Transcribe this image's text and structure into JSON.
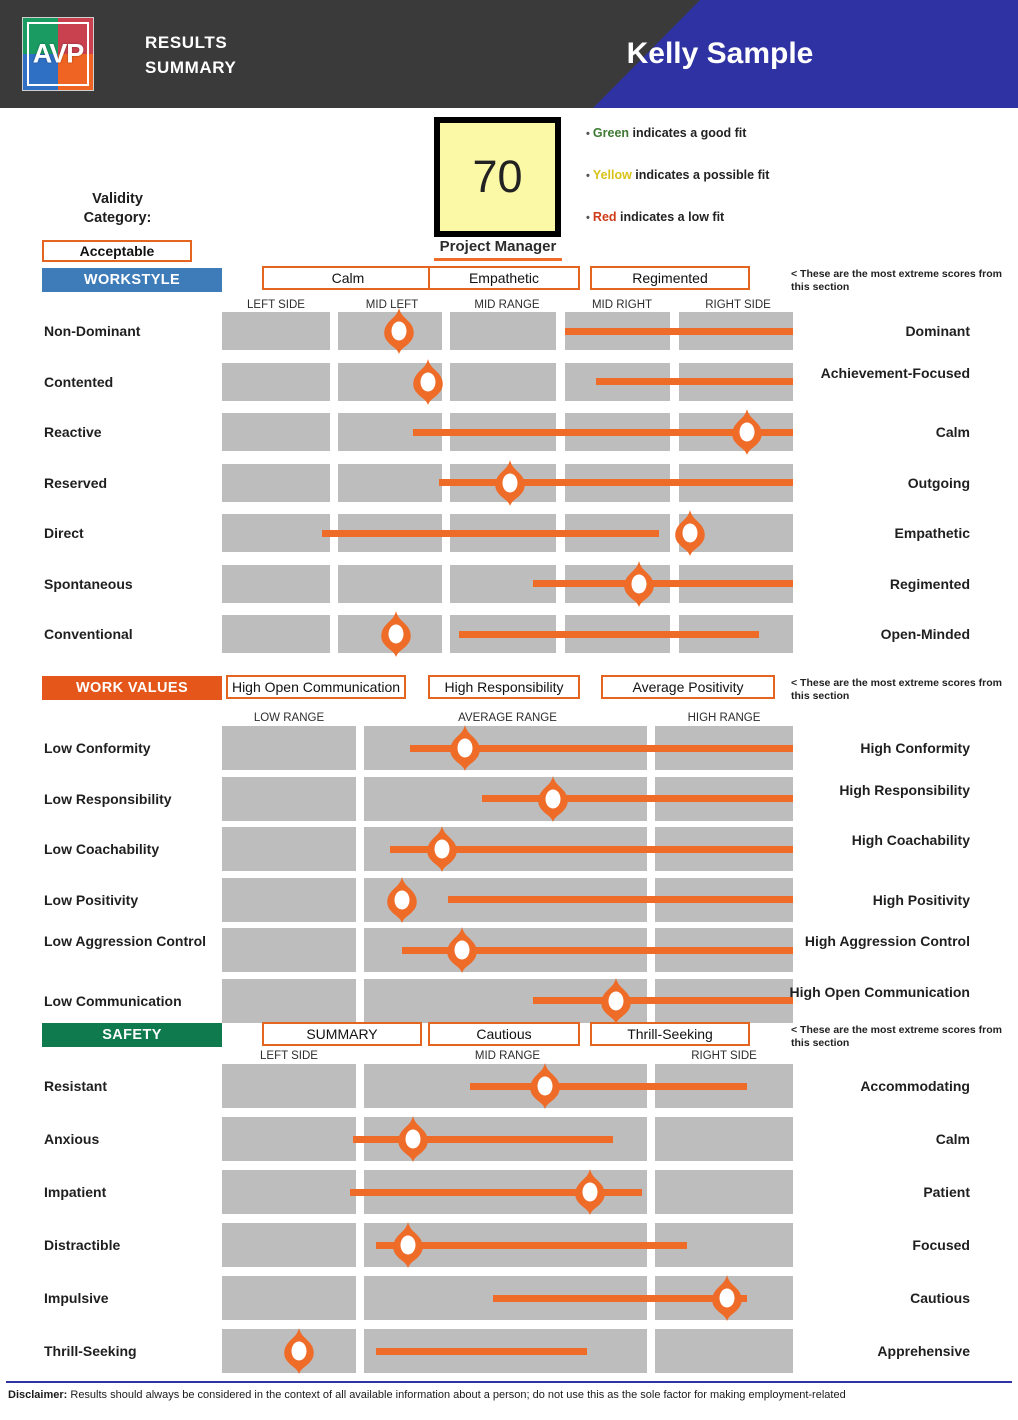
{
  "header": {
    "logo_text": "AVP",
    "report_title_line1": "RESULTS",
    "report_title_line2": "SUMMARY",
    "candidate_name": "Kelly Sample",
    "colors": {
      "dark": "#3a3a3a",
      "blue": "#2f32a2",
      "logo_green": "#1a9b62",
      "logo_red": "#c9414e",
      "logo_blue": "#2f6fc4",
      "logo_orange": "#ef6422"
    }
  },
  "score": {
    "value": "70",
    "role": "Project Manager",
    "box_fill": "#fbf8a6"
  },
  "legend": {
    "bullet": "•",
    "items": [
      {
        "keyword": "Green",
        "rest": " indicates a good fit",
        "color": "#3f7a34"
      },
      {
        "keyword": "Yellow",
        "rest": " indicates a possible fit",
        "color": "#d8c318"
      },
      {
        "keyword": "Red",
        "rest": " indicates a low fit",
        "color": "#cf3b18"
      }
    ]
  },
  "validity": {
    "label_line1": "Validity",
    "label_line2": "Category:",
    "value": "Acceptable"
  },
  "extreme_note": "< These are the most extreme scores from this section",
  "accent_color": "#ee6b28",
  "sections": [
    {
      "id": "workstyle",
      "banner": "WORKSTYLE",
      "banner_color": "#3e7cb9",
      "extreme_scores": [
        "Calm",
        "Empathetic",
        "Regimented"
      ],
      "column_labels": [
        "LEFT SIDE",
        "MID LEFT",
        "MID RANGE",
        "MID RIGHT",
        "RIGHT SIDE"
      ],
      "rows": [
        {
          "left": "Non-Dominant",
          "right": "Dominant",
          "marker_pct": 31.0,
          "range_start_pct": 60.0,
          "range_end_pct": 100.0
        },
        {
          "left": "Contented",
          "right": "Achievement-Focused",
          "marker_pct": 36.0,
          "range_start_pct": 65.5,
          "range_end_pct": 100.0
        },
        {
          "left": "Reactive",
          "right": "Calm",
          "marker_pct": 92.0,
          "range_start_pct": 33.5,
          "range_end_pct": 100.0
        },
        {
          "left": "Reserved",
          "right": "Outgoing",
          "marker_pct": 50.5,
          "range_start_pct": 38.0,
          "range_end_pct": 100.0
        },
        {
          "left": "Direct",
          "right": "Empathetic",
          "marker_pct": 82.0,
          "range_start_pct": 17.5,
          "range_end_pct": 76.5
        },
        {
          "left": "Spontaneous",
          "right": "Regimented",
          "marker_pct": 73.0,
          "range_start_pct": 54.5,
          "range_end_pct": 100.0
        },
        {
          "left": "Conventional",
          "right": "Open-Minded",
          "marker_pct": 30.5,
          "range_start_pct": 41.5,
          "range_end_pct": 94.0
        }
      ]
    },
    {
      "id": "work-values",
      "banner": "WORK VALUES",
      "banner_color": "#e4561a",
      "extreme_scores": [
        "High Open Communication",
        "High Responsibility",
        "Average Positivity"
      ],
      "column_labels": [
        "LOW RANGE",
        "AVERAGE RANGE",
        "HIGH RANGE"
      ],
      "rows": [
        {
          "left": "Low Conformity",
          "right": "High Conformity",
          "marker_pct": 42.5,
          "range_start_pct": 33.0,
          "range_end_pct": 100.0
        },
        {
          "left": "Low Responsibility",
          "right": "High Responsibility",
          "marker_pct": 58.0,
          "range_start_pct": 45.5,
          "range_end_pct": 100.0
        },
        {
          "left": "Low Coachability",
          "right": "High Coachability",
          "marker_pct": 38.5,
          "range_start_pct": 29.5,
          "range_end_pct": 100.0
        },
        {
          "left": "Low Positivity",
          "right": "High Positivity",
          "marker_pct": 31.5,
          "range_start_pct": 39.5,
          "range_end_pct": 100.0
        },
        {
          "left": "Low Aggression Control",
          "right": "High Aggression Control",
          "marker_pct": 42.0,
          "range_start_pct": 31.5,
          "range_end_pct": 100.0
        },
        {
          "left": "Low Communication",
          "right": "High Open Communication",
          "marker_pct": 69.0,
          "range_start_pct": 54.5,
          "range_end_pct": 100.0
        }
      ]
    },
    {
      "id": "safety",
      "banner": "SAFETY",
      "banner_color": "#0e7a4e",
      "extreme_scores": [
        "SUMMARY",
        "Cautious",
        "Thrill-Seeking"
      ],
      "column_labels": [
        "LEFT SIDE",
        "MID RANGE",
        "RIGHT SIDE"
      ],
      "rows": [
        {
          "left": "Resistant",
          "right": "Accommodating",
          "marker_pct": 56.5,
          "range_start_pct": 43.5,
          "range_end_pct": 92.0
        },
        {
          "left": "Anxious",
          "right": "Calm",
          "marker_pct": 33.5,
          "range_start_pct": 23.0,
          "range_end_pct": 68.5
        },
        {
          "left": "Impatient",
          "right": "Patient",
          "marker_pct": 64.5,
          "range_start_pct": 22.5,
          "range_end_pct": 73.5
        },
        {
          "left": "Distractible",
          "right": "Focused",
          "marker_pct": 32.5,
          "range_start_pct": 27.0,
          "range_end_pct": 81.5
        },
        {
          "left": "Impulsive",
          "right": "Cautious",
          "marker_pct": 88.5,
          "range_start_pct": 47.5,
          "range_end_pct": 92.0
        },
        {
          "left": "Thrill-Seeking",
          "right": "Apprehensive",
          "marker_pct": 13.5,
          "range_start_pct": 27.0,
          "range_end_pct": 64.0
        }
      ]
    }
  ],
  "disclaimer": {
    "prefix": "Disclaimer:",
    "text": " Results should always be considered in the context of all available information about a person; do not use this as the sole factor for making employment-related"
  }
}
